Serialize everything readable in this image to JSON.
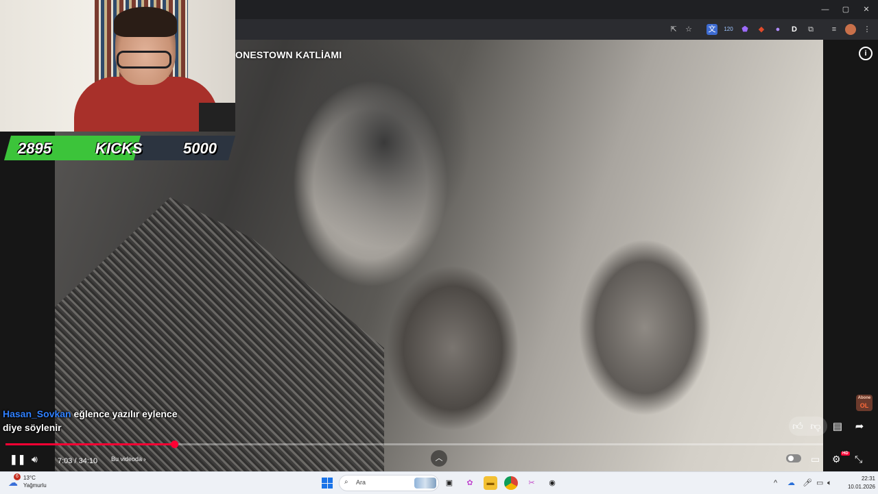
{
  "browser": {
    "window_controls": {
      "minimize": "—",
      "maximize": "▢",
      "close": "✕"
    },
    "extension_badge": "120",
    "profile_letter": "D"
  },
  "video": {
    "title": "ONESTOWN KATLİAMI",
    "info": "i"
  },
  "overlay": {
    "kick_count": "2895",
    "kick_label": "KICKS",
    "kick_goal": "5000",
    "kick_progress": 0.579,
    "kick_colors": {
      "fill": "#3cc43a",
      "empty": "#2c3440"
    }
  },
  "chat": {
    "username": "Hasan_Sovkan",
    "message": "eğlence yazılır eylence",
    "message_line2": "diye söylenir"
  },
  "abone_badge": {
    "top": "Abone",
    "bottom": "OL"
  },
  "player": {
    "current_time": "7:03",
    "separator": " / ",
    "duration": "34:10",
    "progress": 0.2063,
    "chapter_label": "Bu videoda",
    "chapter_chevron": "›",
    "hd_badge": "HD",
    "accent_color": "#ff0033"
  },
  "taskbar": {
    "weather_badge": "6",
    "temperature": "13°C",
    "condition": "Yağmurlu",
    "search_placeholder": "Ara",
    "time": "22:31",
    "date": "10.01.2026"
  }
}
